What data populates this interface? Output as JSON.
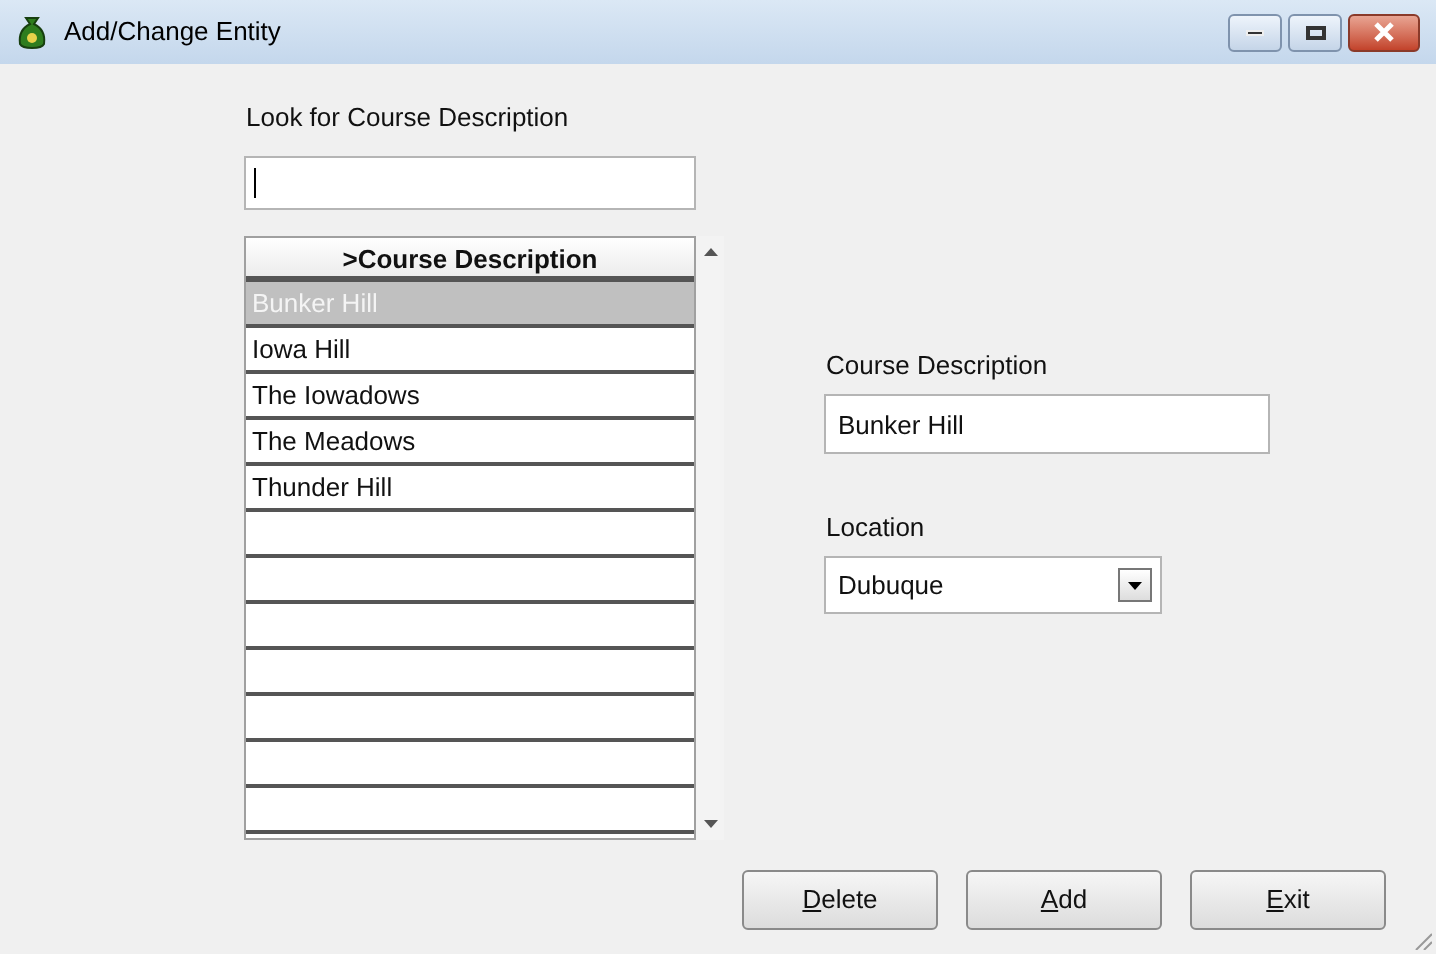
{
  "window": {
    "title": "Add/Change Entity"
  },
  "search": {
    "label": "Look for Course Description"
  },
  "list": {
    "header": ">Course Description",
    "rows": [
      {
        "text": "Bunker Hill",
        "selected": true
      },
      {
        "text": "Iowa Hill",
        "selected": false
      },
      {
        "text": "The Iowadows",
        "selected": false
      },
      {
        "text": "The Meadows",
        "selected": false
      },
      {
        "text": "Thunder Hill",
        "selected": false
      }
    ]
  },
  "course_description": {
    "label": "Course Description",
    "value": "Bunker Hill"
  },
  "location": {
    "label": "Location",
    "value": "Dubuque"
  },
  "buttons": [
    {
      "key": "D",
      "rest": "elete"
    },
    {
      "key": "A",
      "rest": "dd"
    },
    {
      "key": "E",
      "rest": "xit"
    }
  ]
}
